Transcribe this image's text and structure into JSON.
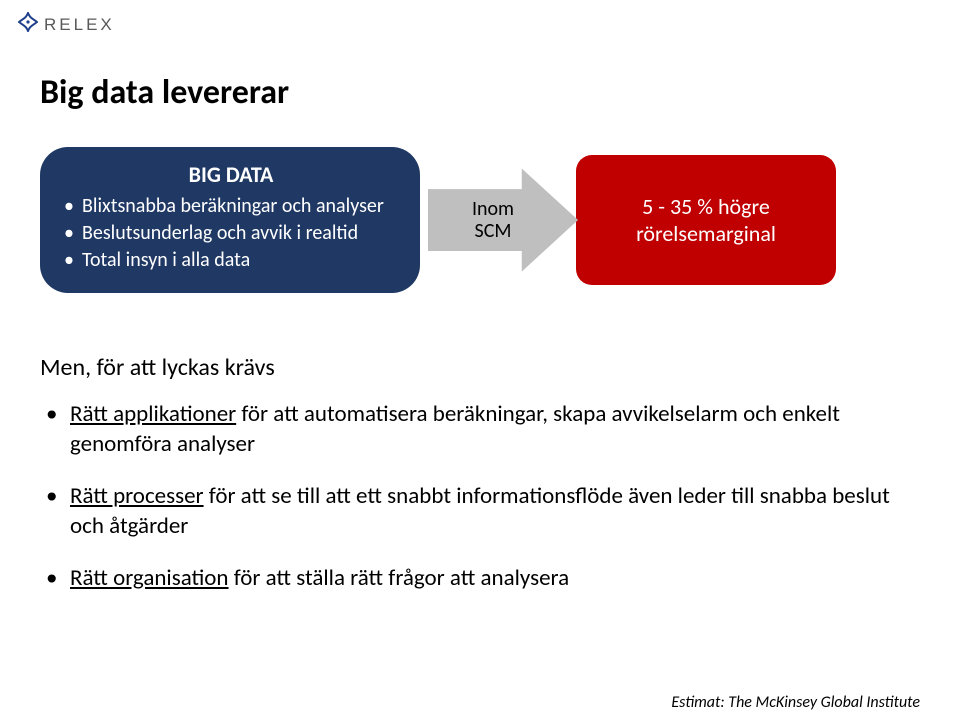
{
  "logo": {
    "text": "RELEX"
  },
  "title": "Big data levererar",
  "bigdata": {
    "heading": "BIG DATA",
    "items": [
      "Blixtsnabba beräkningar och analyser",
      "Beslutsunderlag och avvik i realtid",
      "Total insyn i alla data"
    ]
  },
  "arrow": {
    "line1": "Inom",
    "line2": "SCM"
  },
  "outcome": {
    "line1": "5 - 35 % högre",
    "line2": "rörelsemarginal"
  },
  "subhead": "Men, för att lyckas krävs",
  "bullets": [
    {
      "lead": "Rätt applikationer",
      "rest": " för att automatisera beräkningar, skapa avvikelselarm och enkelt genomföra analyser"
    },
    {
      "lead": "Rätt processer",
      "rest": " för att se till att ett snabbt informationsflöde även leder till snabba beslut och åtgärder"
    },
    {
      "lead": "Rätt organisation",
      "rest": " för att ställa rätt frågor att analysera"
    }
  ],
  "source": "Estimat: The McKinsey Global Institute"
}
